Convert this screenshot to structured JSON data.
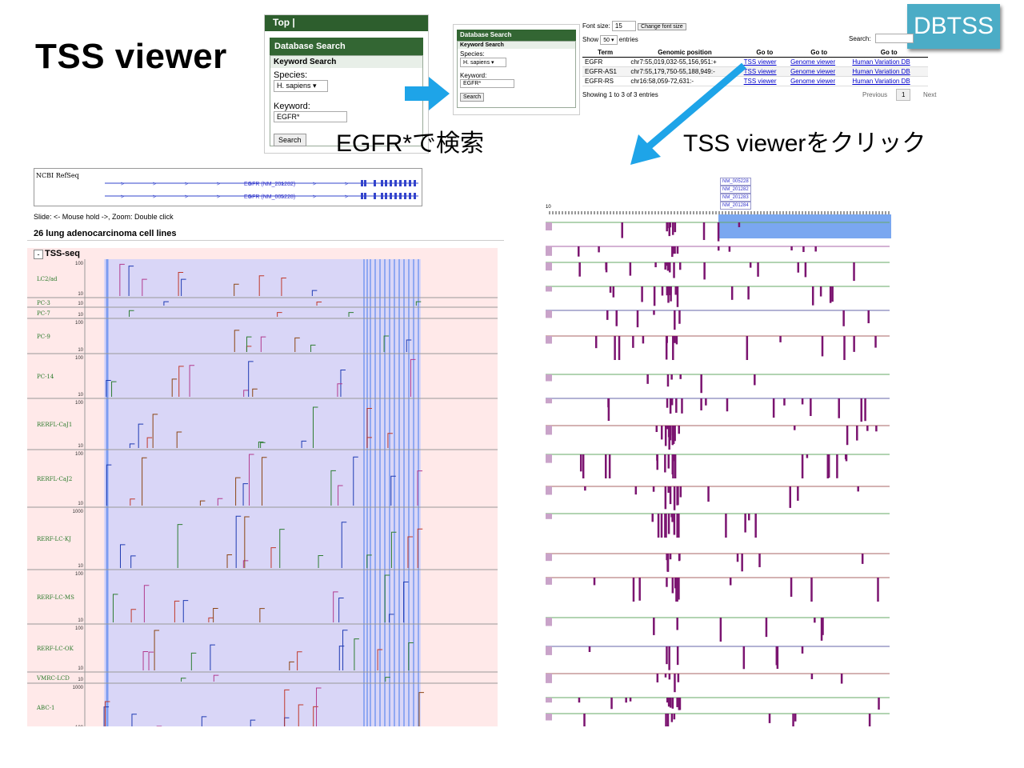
{
  "slide": {
    "title": "TSS viewer",
    "badge": "DBTSS",
    "caption_search": "EGFR*で検索",
    "caption_click": "TSS viewerをクリック"
  },
  "search_panel": {
    "top_label": "Top |",
    "header": "Database Search",
    "subheader": "Keyword Search",
    "species_label": "Species:",
    "species_value": "H. sapiens",
    "keyword_label": "Keyword:",
    "keyword_value": "EGFR*",
    "search_button": "Search"
  },
  "results": {
    "font_size_label": "Font size:",
    "font_size_value": "15",
    "change_font_button": "Change font size",
    "show_label": "Show",
    "show_value": "50",
    "entries_label": "entries",
    "search_label": "Search:",
    "columns": [
      "Term",
      "Genomic position",
      "Go to",
      "Go to",
      "Go to"
    ],
    "rows": [
      [
        "EGFR",
        "chr7:55,019,032-55,156,951:+",
        "TSS viewer",
        "Genome viewer",
        "Human Variation DB"
      ],
      [
        "EGFR-AS1",
        "chr7:55,179,750-55,188,949:-",
        "TSS viewer",
        "Genome viewer",
        "Human Variation DB"
      ],
      [
        "EGFR-RS",
        "chr16:58,059-72,631:-",
        "TSS viewer",
        "Genome viewer",
        "Human Variation DB"
      ]
    ],
    "info": "Showing 1 to 3 of 3 entries",
    "prev": "Previous",
    "page": "1",
    "next": "Next"
  },
  "left_viewer": {
    "refseq_label": "NCBI RefSeq",
    "transcripts": [
      "EGFR (NM_201282)",
      "EGFR (NM_005228)"
    ],
    "slide_hint": "Slide: <- Mouse hold ->, Zoom: Double click",
    "section_title": "26 lung adenocarcinoma cell lines",
    "track_title": "TSS-seq",
    "collapse": "-",
    "tracks": [
      {
        "name": "LC2/ad",
        "top": "100",
        "bottom": "10"
      },
      {
        "name": "PC-3",
        "top": "",
        "bottom": "10"
      },
      {
        "name": "PC-7",
        "top": "",
        "bottom": "10"
      },
      {
        "name": "PC-9",
        "top": "100",
        "bottom": "10"
      },
      {
        "name": "PC-14",
        "top": "100",
        "bottom": "10"
      },
      {
        "name": "RERFL-CaJ1",
        "top": "100",
        "bottom": "10"
      },
      {
        "name": "RERFL-CaJ2",
        "top": "100",
        "bottom": "10"
      },
      {
        "name": "RERF-LC-KJ",
        "top": "1000",
        "bottom": "10"
      },
      {
        "name": "RERF-LC-MS",
        "top": "100",
        "bottom": "10"
      },
      {
        "name": "RERF-LC-OK",
        "top": "100",
        "bottom": "10"
      },
      {
        "name": "VMRC-LCD",
        "top": "",
        "bottom": "10"
      },
      {
        "name": "ABC-1",
        "top": "1000",
        "bottom": "100"
      }
    ]
  },
  "right_viewer": {
    "transcripts": [
      "NM_005228",
      "NM_201282",
      "NM_201283",
      "NM_201284"
    ],
    "scale_start": "10"
  },
  "colors": {
    "badge": "#4bacc6",
    "arrow": "#1ea4e8",
    "green": "#2d5e2d",
    "tss_bg": "#ffe9e9",
    "region": "#d9d6f7",
    "exon": "#7d9cf0",
    "bar": "#7b1470"
  }
}
